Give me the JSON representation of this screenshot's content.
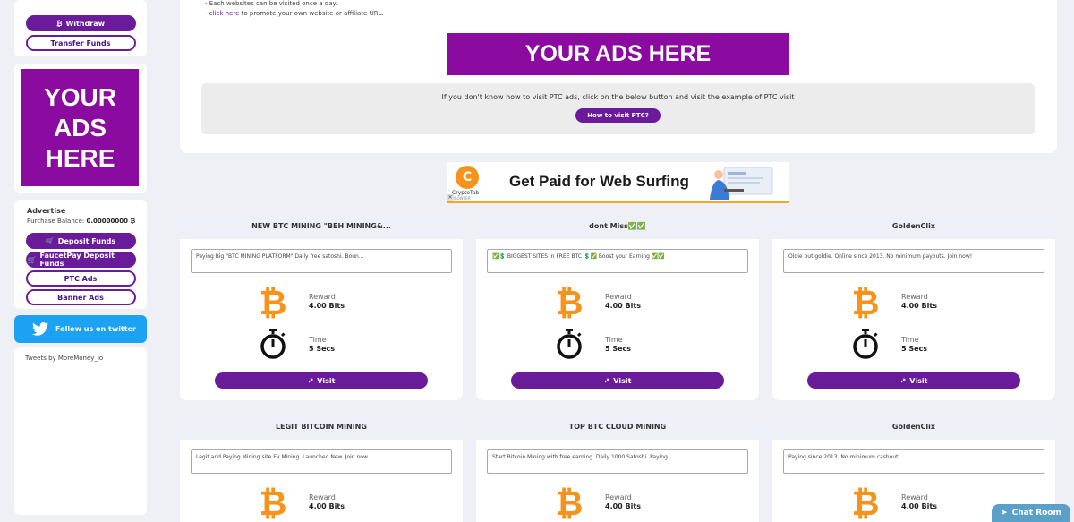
{
  "sidebar": {
    "withdraw_label": "Withdraw",
    "transfer_label": "Transfer Funds",
    "ad_square_text": "YOUR ADS HERE",
    "advertise_title": "Advertise",
    "purchase_balance_label": "Purchase Balance:",
    "purchase_balance_value": "0.00000000 ₿",
    "deposit_funds_label": "Deposit Funds",
    "faucetpay_label": "FaucetPay Deposit Funds",
    "ptc_ads_label": "PTC Ads",
    "banner_ads_label": "Banner Ads",
    "twitter_label": "Follow us on twitter",
    "tweets_by": "Tweets by MoreMoney_io"
  },
  "top": {
    "rule1": "- Each websites can be visited once a day.",
    "rule2_link": "click here",
    "rule2_rest": " to promote your own website or affiliate URL.",
    "banner_text": "YOUR ADS HERE",
    "howto_text": "If you don't know how to visit PTC ads, click on the below button and visit the example of PTC visit",
    "howto_button": "How to visit PTC?"
  },
  "cryptotab": {
    "brand": "CryptoTab",
    "sub": "BROWSER",
    "headline": "Get Paid for Web Surfing"
  },
  "ptc_labels": {
    "reward": "Reward",
    "time": "Time",
    "visit": "Visit"
  },
  "ptc_ads": [
    {
      "title": "NEW BTC MINING \"BEH MINING&...",
      "desc": "Paying Big \"BTC MINING PLATFORM\" Daily free satoshi. Boun...",
      "reward": "4.00 Bits",
      "time": "5 Secs"
    },
    {
      "title": "dont Miss✅✅",
      "desc": "✅💲 BIGGEST SITES in FREE BTC 💲✅ Boost your Earning ✅✅",
      "reward": "4.00 Bits",
      "time": "5 Secs"
    },
    {
      "title": "GoldenClix",
      "desc": "Oldie but goldie. Online since 2013. No minimum payouts. Join now!",
      "reward": "4.00 Bits",
      "time": "5 Secs"
    },
    {
      "title": "LEGIT BITCOIN MINING",
      "desc": "Legit and Paying Mining site Ev Mining. Launched New. Join now.",
      "reward": "4.00 Bits",
      "time": ""
    },
    {
      "title": "TOP BTC CLOUD MINING",
      "desc": "Start Bitcoin Mining with free earning. Daily 1000 Satoshi. Paying",
      "reward": "4.00 Bits",
      "time": ""
    },
    {
      "title": "GoldenClix",
      "desc": "Paying since 2013. No minimum cashout.",
      "reward": "4.00 Bits",
      "time": ""
    }
  ],
  "chat_label": "Chat Room",
  "colors": {
    "accent": "#6a1b9a",
    "ad_purple": "#8b0aa0",
    "bitcoin": "#f7931a",
    "twitter": "#1da1f2"
  }
}
